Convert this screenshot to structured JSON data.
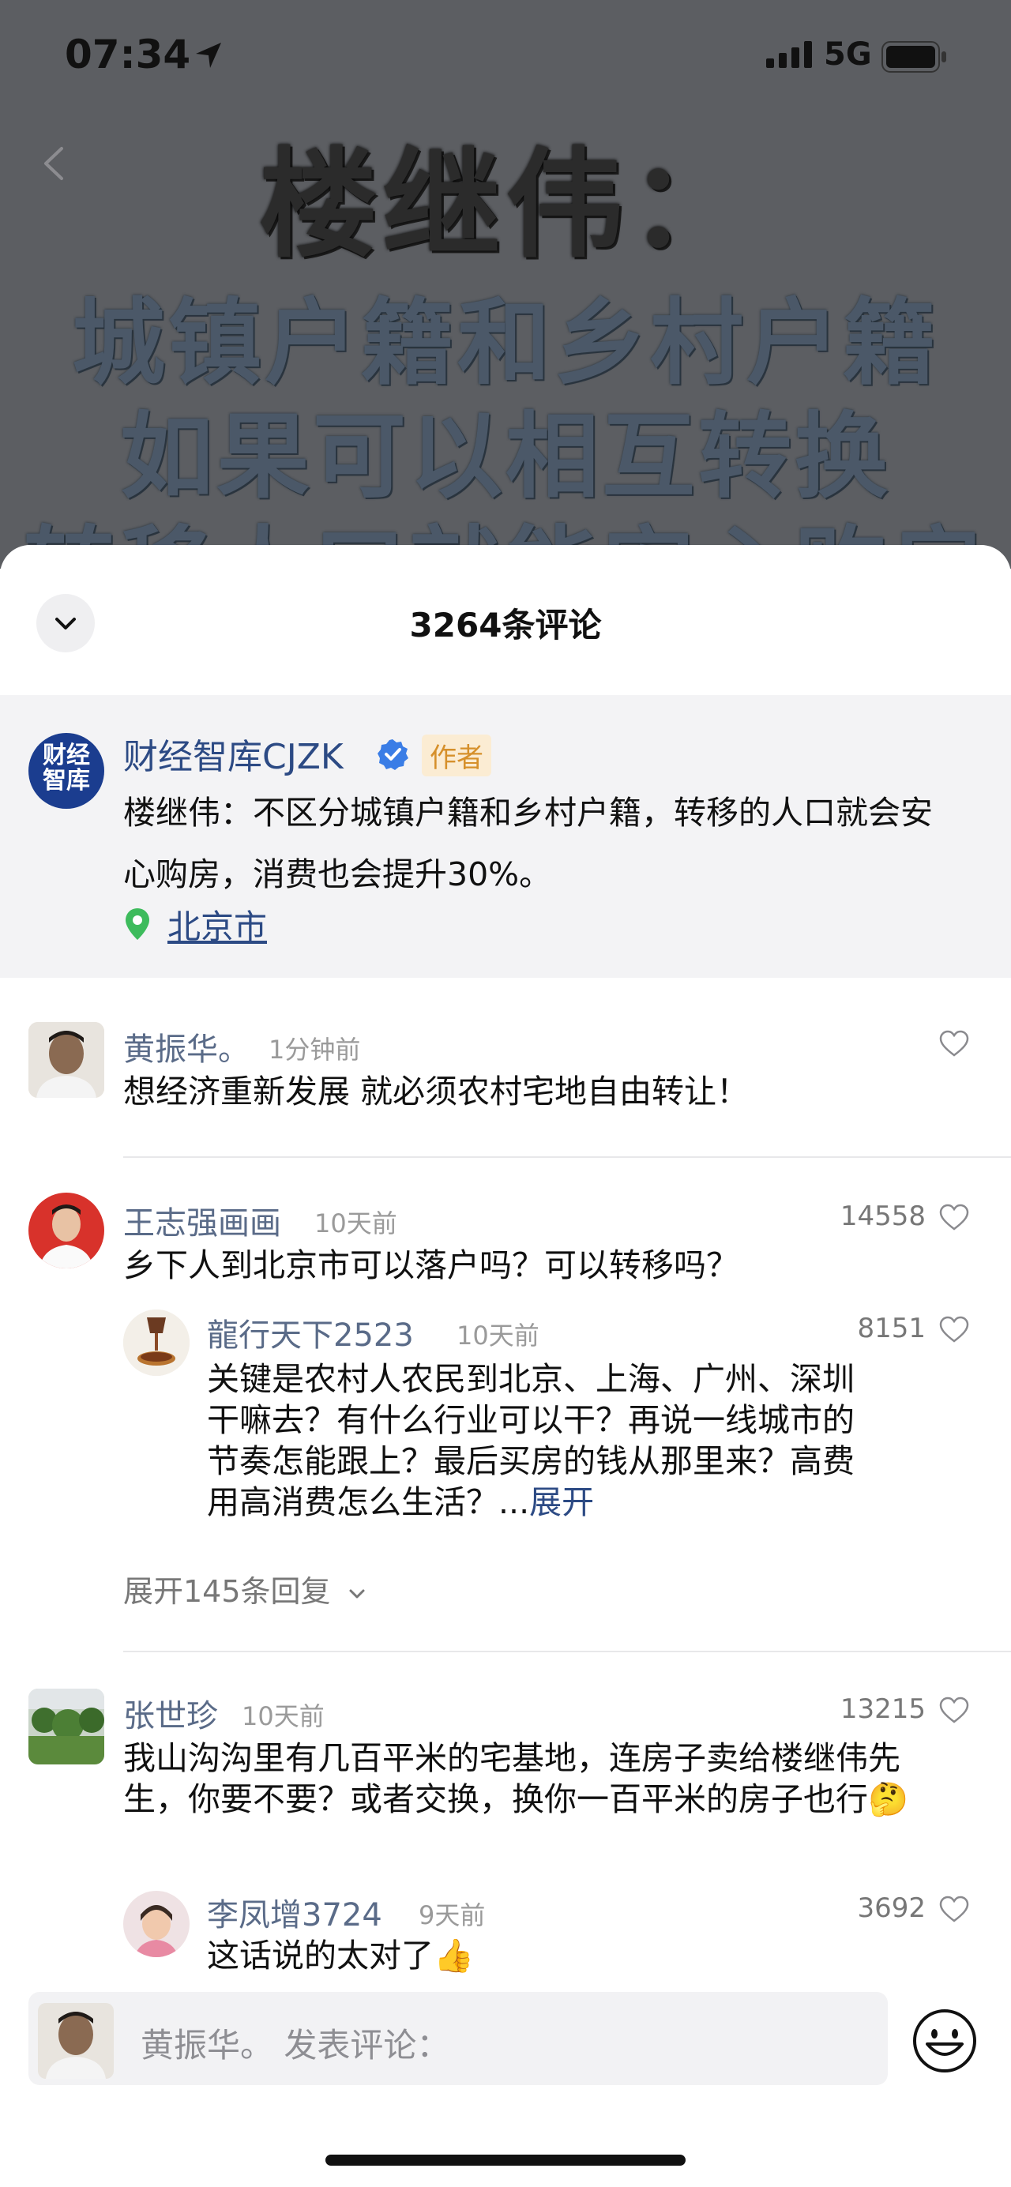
{
  "status_bar": {
    "time": "07:34",
    "network": "5G"
  },
  "video": {
    "headline_line1": "楼继伟：",
    "headline_line2": "城镇户籍和乡村户籍",
    "headline_line3": "如果可以相互转换",
    "headline_line4": "转移人口就能安心购房"
  },
  "sheet": {
    "comment_count": "3264条评论",
    "author_post": {
      "name": "财经智库CJZK",
      "badge": "作者",
      "logo_line1": "财经",
      "logo_line2": "智库",
      "text": "楼继伟：不区分城镇户籍和乡村户籍，转移的人口就会安心购房，消费也会提升30%。",
      "location": "北京市"
    },
    "comments": [
      {
        "name": "黄振华。",
        "time": "1分钟前",
        "likes": "",
        "text": "想经济重新发展 就必须农村宅地自由转让！"
      },
      {
        "name": "王志强画画",
        "time": "10天前",
        "likes": "14558",
        "text": "乡下人到北京市可以落户吗？可以转移吗？",
        "reply": {
          "name": "龍行天下2523",
          "time": "10天前",
          "likes": "8151",
          "text": "关键是农村人农民到北京、上海、广州、深圳干嘛去？有什么行业可以干？再说一线城市的节奏怎能跟上？最后买房的钱从那里来？高费用高消费怎么生活？...",
          "expand": "展开"
        },
        "more_replies": "展开145条回复"
      },
      {
        "name": "张世珍",
        "time": "10天前",
        "likes": "13215",
        "text": "我山沟沟里有几百平米的宅基地，连房子卖给楼继伟先生，你要不要？或者交换，换你一百平米的房子也行🤔",
        "reply": {
          "name": "李凤增3724",
          "time": "9天前",
          "likes": "3692",
          "text": "这话说的太对了👍"
        }
      }
    ]
  },
  "composer": {
    "placeholder": "黄振华。 发表评论："
  },
  "colors": {
    "link": "#2c4a84",
    "author_tag": "#d6902b",
    "card_bg": "#f3f3f5"
  }
}
